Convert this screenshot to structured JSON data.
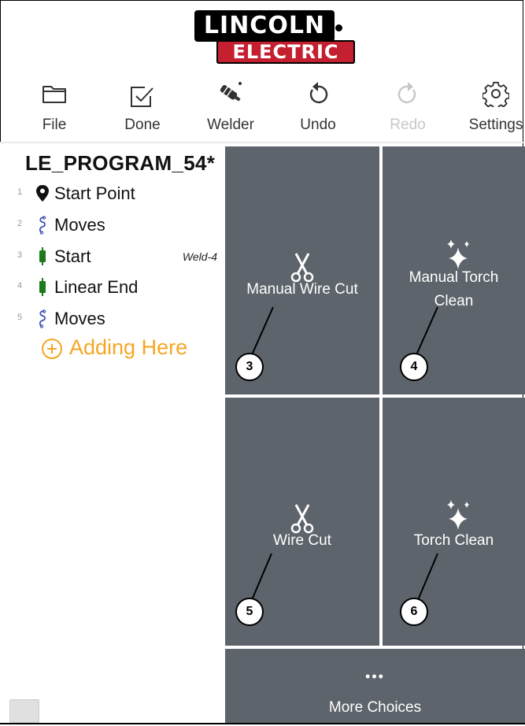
{
  "logo": {
    "line1": "LINCOLN",
    "line2": "ELECTRIC",
    "colors": {
      "black": "#000000",
      "red": "#c4202f"
    }
  },
  "toolbar": {
    "items": [
      {
        "label": "File",
        "icon": "folder-icon",
        "enabled": true
      },
      {
        "label": "Done",
        "icon": "checkbox-icon",
        "enabled": true
      },
      {
        "label": "Welder",
        "icon": "welding-torch-icon",
        "enabled": true
      },
      {
        "label": "Undo",
        "icon": "undo-icon",
        "enabled": true
      },
      {
        "label": "Redo",
        "icon": "redo-icon",
        "enabled": false
      },
      {
        "label": "Settings",
        "icon": "gear-icon",
        "enabled": true
      }
    ]
  },
  "program": {
    "title": "LE_PROGRAM_54*",
    "steps": [
      {
        "num": "1",
        "label": "Start Point",
        "icon": "location-pin-icon"
      },
      {
        "num": "2",
        "label": "Moves",
        "icon": "path-squiggle-icon"
      },
      {
        "num": "3",
        "label": "Start",
        "icon": "weld-start-icon",
        "tag": "Weld-4"
      },
      {
        "num": "4",
        "label": "Linear End",
        "icon": "weld-end-icon"
      },
      {
        "num": "5",
        "label": "Moves",
        "icon": "path-squiggle-icon"
      }
    ],
    "adding": "Adding Here"
  },
  "tiles": {
    "manual_wire_cut": {
      "label": "Manual Wire Cut",
      "icon": "scissors-icon",
      "callout": "3"
    },
    "manual_torch_clean": {
      "label_line1": "Manual Torch",
      "label_line2": "Clean",
      "icon": "sparkle-icon",
      "callout": "4"
    },
    "wire_cut": {
      "label": "Wire Cut",
      "icon": "scissors-icon",
      "callout": "5"
    },
    "torch_clean": {
      "label": "Torch Clean",
      "icon": "sparkle-icon",
      "callout": "6"
    },
    "more": {
      "label": "More Choices",
      "icon": "ellipsis-icon",
      "dots": "•••"
    }
  },
  "colors": {
    "tile": "#5e646b",
    "accent": "#f5a623",
    "path": "#3f51b5",
    "weld": "#1b7a1b"
  }
}
